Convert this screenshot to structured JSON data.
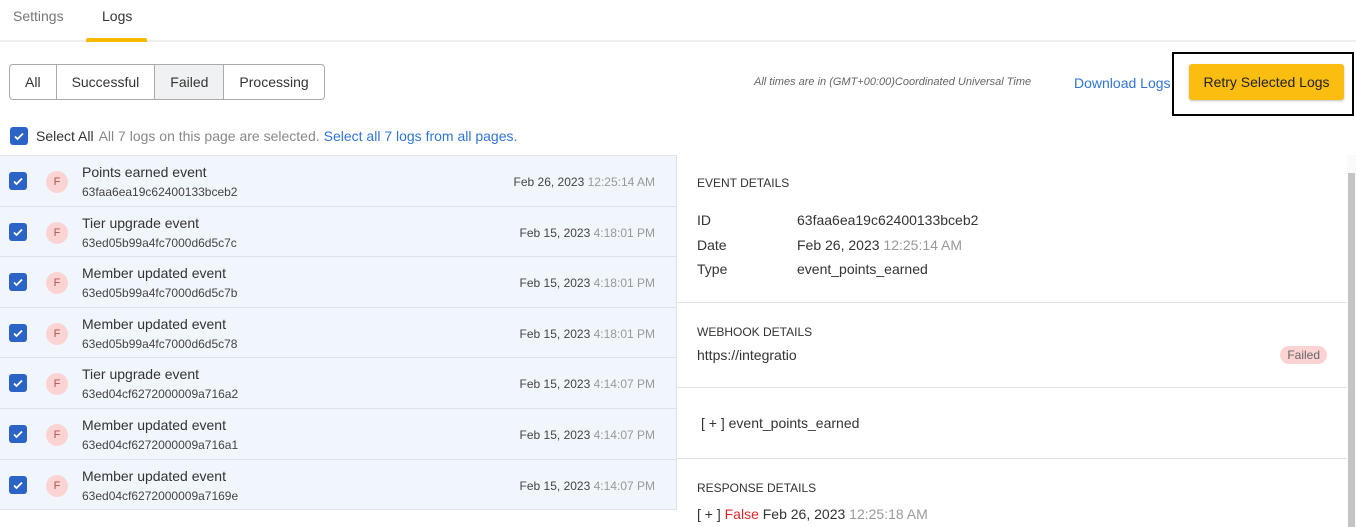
{
  "tabs": [
    {
      "label": "Settings",
      "active": false
    },
    {
      "label": "Logs",
      "active": true
    }
  ],
  "filters": {
    "options": [
      "All",
      "Successful",
      "Failed",
      "Processing"
    ],
    "selected": "Failed"
  },
  "timezone_note": "All times are in (GMT+00:00)Coordinated Universal Time",
  "download_label": "Download Logs",
  "retry_label": "Retry Selected Logs",
  "select_all": {
    "label": "Select All",
    "status": "All 7 logs on this page are selected.",
    "link": "Select all 7 logs from all pages.",
    "checked": true
  },
  "logs": [
    {
      "title": "Points earned event",
      "id": "63faa6ea19c62400133bceb2",
      "date": "Feb 26, 2023",
      "time": "12:25:14 AM",
      "badge": "F",
      "checked": true
    },
    {
      "title": "Tier upgrade event",
      "id": "63ed05b99a4fc7000d6d5c7c",
      "date": "Feb 15, 2023",
      "time": "4:18:01 PM",
      "badge": "F",
      "checked": true
    },
    {
      "title": "Member updated event",
      "id": "63ed05b99a4fc7000d6d5c7b",
      "date": "Feb 15, 2023",
      "time": "4:18:01 PM",
      "badge": "F",
      "checked": true
    },
    {
      "title": "Member updated event",
      "id": "63ed05b99a4fc7000d6d5c78",
      "date": "Feb 15, 2023",
      "time": "4:18:01 PM",
      "badge": "F",
      "checked": true
    },
    {
      "title": "Tier upgrade event",
      "id": "63ed04cf6272000009a716a2",
      "date": "Feb 15, 2023",
      "time": "4:14:07 PM",
      "badge": "F",
      "checked": true
    },
    {
      "title": "Member updated event",
      "id": "63ed04cf6272000009a716a1",
      "date": "Feb 15, 2023",
      "time": "4:14:07 PM",
      "badge": "F",
      "checked": true
    },
    {
      "title": "Member updated event",
      "id": "63ed04cf6272000009a7169e",
      "date": "Feb 15, 2023",
      "time": "4:14:07 PM",
      "badge": "F",
      "checked": true
    }
  ],
  "detail": {
    "event_heading": "EVENT DETAILS",
    "id_label": "ID",
    "id": "63faa6ea19c62400133bceb2",
    "date_label": "Date",
    "date": "Feb 26, 2023",
    "time": "12:25:14 AM",
    "type_label": "Type",
    "type": "event_points_earned",
    "webhook_heading": "WEBHOOK DETAILS",
    "webhook_url": "https://integratio",
    "webhook_status": "Failed",
    "payload_toggle": "[ + ]",
    "payload_label": "event_points_earned",
    "response_heading": "RESPONSE DETAILS",
    "response_toggle": "[ + ]",
    "response_result": "False",
    "response_date": "Feb 26, 2023",
    "response_time": "12:25:18 AM"
  },
  "colors": {
    "accent": "#fbbd0f",
    "link": "#2f75d6",
    "checkbox": "#2b64c6",
    "failed": "#e0292b"
  }
}
